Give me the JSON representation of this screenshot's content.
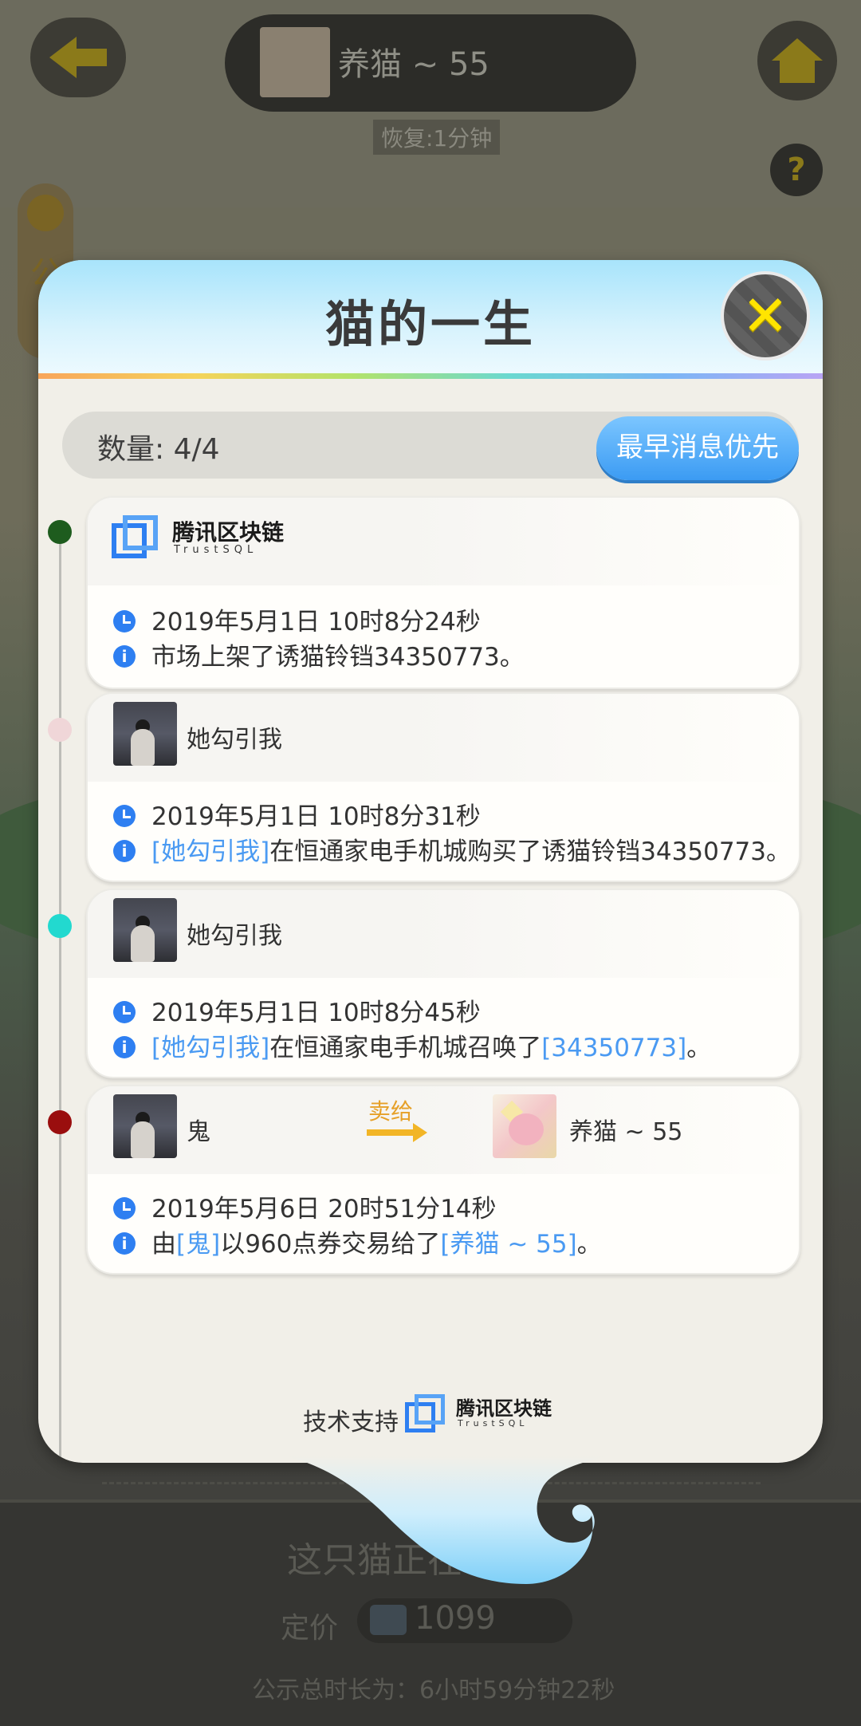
{
  "background": {
    "title": "养猫 ~ 55",
    "recover": "恢复:1分钟",
    "side_tab": "公",
    "panel_text": "这只猫正在公示中",
    "price_label": "定价",
    "price": "1099",
    "total_time": "公示总时长为：6小时59分钟22秒"
  },
  "modal": {
    "title": "猫的一生",
    "count_label": "数量: 4/4",
    "sort_button": "最早消息优先",
    "footer_text": "技术支持"
  },
  "logo": {
    "cn": "腾讯区块链",
    "en": "TrustSQL"
  },
  "colors": {
    "accent": "#3b9bf3",
    "link": "#4a9af2",
    "close_x": "#ffe500",
    "sold": "#f2b526"
  },
  "events": [
    {
      "dot_color": "#1e5c1e",
      "time": "2019年5月1日 10时8分24秒",
      "desc": "市场上架了诱猫铃铛34350773。"
    },
    {
      "dot_color": "#f0d6d8",
      "user": "她勾引我",
      "time": "2019年5月1日 10时8分31秒",
      "desc_link": "[她勾引我]",
      "desc_rest": "在恒通家电手机城购买了诱猫铃铛34350773。"
    },
    {
      "dot_color": "#22d9cf",
      "user": "她勾引我",
      "time": "2019年5月1日 10时8分45秒",
      "desc_link": "[她勾引我]",
      "desc_mid": "在恒通家电手机城召唤了",
      "desc_link2": "[34350773]",
      "desc_end": "。"
    },
    {
      "dot_color": "#9a0e0e",
      "user": "鬼",
      "sold_label": "卖给",
      "buyer": "养猫 ~ 55",
      "time": "2019年5月6日 20时51分14秒",
      "desc_pre": "由",
      "desc_link": "[鬼]",
      "desc_mid": "以960点券交易给了",
      "desc_link2": "[养猫 ~ 55]",
      "desc_end": "。"
    }
  ]
}
